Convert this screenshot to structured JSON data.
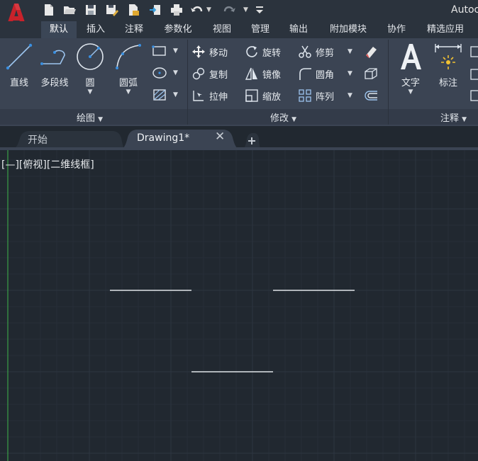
{
  "app": {
    "title": "Autoc"
  },
  "quick_access": {
    "icons": [
      "logo-icon",
      "new-icon",
      "open-icon",
      "save-icon",
      "save-as-icon",
      "publish-icon",
      "import-icon",
      "print-icon",
      "undo-icon",
      "redo-icon",
      "customize-icon"
    ]
  },
  "ribbon_tabs": [
    {
      "label": "默认",
      "active": true
    },
    {
      "label": "插入"
    },
    {
      "label": "注释"
    },
    {
      "label": "参数化"
    },
    {
      "label": "视图"
    },
    {
      "label": "管理"
    },
    {
      "label": "输出"
    },
    {
      "label": "附加模块"
    },
    {
      "label": "协作"
    },
    {
      "label": "精选应用"
    }
  ],
  "draw_panel": {
    "title": "绘图",
    "line": "直线",
    "polyline": "多段线",
    "circle": "圆",
    "arc": "圆弧"
  },
  "modify_panel": {
    "title": "修改",
    "move": "移动",
    "rotate": "旋转",
    "trim": "修剪",
    "copy": "复制",
    "mirror": "镜像",
    "fillet": "圆角",
    "stretch": "拉伸",
    "scale": "缩放",
    "array": "阵列"
  },
  "annotation_panel": {
    "title": "注释",
    "text": "文字",
    "dimension": "标注"
  },
  "doc_tabs": [
    {
      "label": "开始",
      "active": false
    },
    {
      "label": "Drawing1*",
      "active": true
    }
  ],
  "viewport": {
    "label": "[—][俯视][二维线框]"
  },
  "colors": {
    "background": "#212830",
    "ribbon": "#3b4453",
    "grid_minor": "#262e38",
    "grid_major": "#2d3641",
    "line": "#e0e4e8",
    "y_axis": "#3aa048",
    "logo": "#c8222b"
  }
}
